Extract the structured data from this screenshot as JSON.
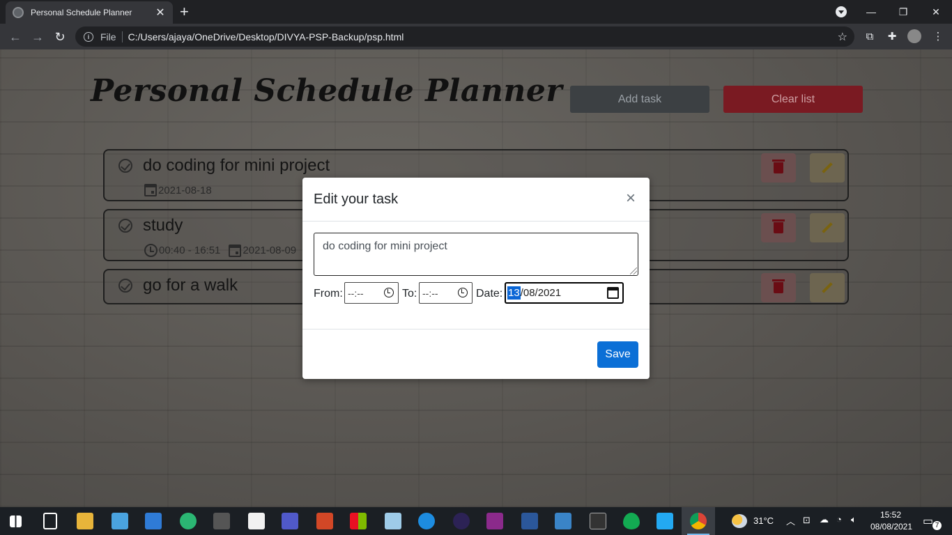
{
  "browser": {
    "tab_title": "Personal Schedule Planner",
    "tab_close": "✕",
    "new_tab": "+",
    "omnibox_scheme": "File",
    "url": "C:/Users/ajaya/OneDrive/Desktop/DIVYA-PSP-Backup/psp.html",
    "window_controls": {
      "minimize": "—",
      "restore": "❐",
      "close": "✕"
    }
  },
  "app": {
    "title": "Personal Schedule Planner",
    "add_task_label": "Add task",
    "clear_list_label": "Clear list"
  },
  "tasks": [
    {
      "name": "do coding for mini project",
      "date": "2021-08-18"
    },
    {
      "name": "study",
      "time": "00:40 - 16:51",
      "date": "2021-08-09"
    },
    {
      "name": "go for a walk"
    }
  ],
  "modal": {
    "title": "Edit your task",
    "close": "×",
    "task_text": "do coding for mini project",
    "from_label": "From:",
    "from_value": "--:--",
    "to_label": "To:",
    "to_value": "--:--",
    "date_label": "Date:",
    "date_day": "13",
    "date_rest": "/08/2021",
    "save_label": "Save"
  },
  "taskbar": {
    "weather": "31°C",
    "time": "15:52",
    "date": "08/08/2021",
    "notifications": "7"
  },
  "colors": {
    "accent": "#0b6fd6",
    "danger": "#7a1a22",
    "browser_dark": "#202124"
  }
}
